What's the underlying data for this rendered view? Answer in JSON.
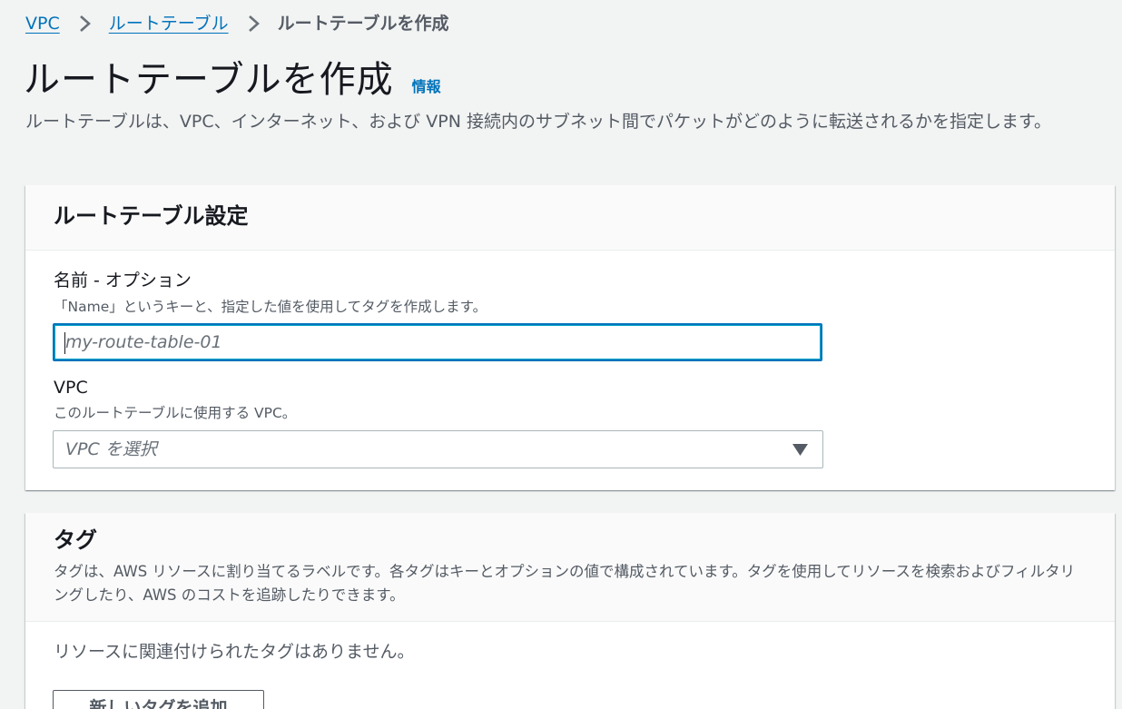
{
  "breadcrumb": {
    "items": [
      {
        "label": "VPC"
      },
      {
        "label": "ルートテーブル"
      }
    ],
    "current": "ルートテーブルを作成"
  },
  "header": {
    "title": "ルートテーブルを作成",
    "info_label": "情報",
    "description": "ルートテーブルは、VPC、インターネット、および VPN 接続内のサブネット間でパケットがどのように転送されるかを指定します。"
  },
  "settings_panel": {
    "title": "ルートテーブル設定",
    "name_field": {
      "label": "名前 - オプション",
      "description": "「Name」というキーと、指定した値を使用してタグを作成します。",
      "value": "",
      "placeholder": "my-route-table-01"
    },
    "vpc_field": {
      "label": "VPC",
      "description": "このルートテーブルに使用する VPC。",
      "placeholder": "VPC を選択"
    }
  },
  "tags_panel": {
    "title": "タグ",
    "description": "タグは、AWS リソースに割り当てるラベルです。各タグはキーとオプションの値で構成されています。タグを使用してリソースを検索およびフィルタリングしたり、AWS のコストを追跡したりできます。",
    "empty_text": "リソースに関連付けられたタグはありません。",
    "add_button_label": "新しいタグを追加"
  },
  "icons": {
    "breadcrumb_separator": "chevron-right-icon",
    "select_caret": "caret-down-icon"
  },
  "colors": {
    "link": "#0073bb",
    "background": "#f2f3f3",
    "focus_border": "#0073bb"
  }
}
